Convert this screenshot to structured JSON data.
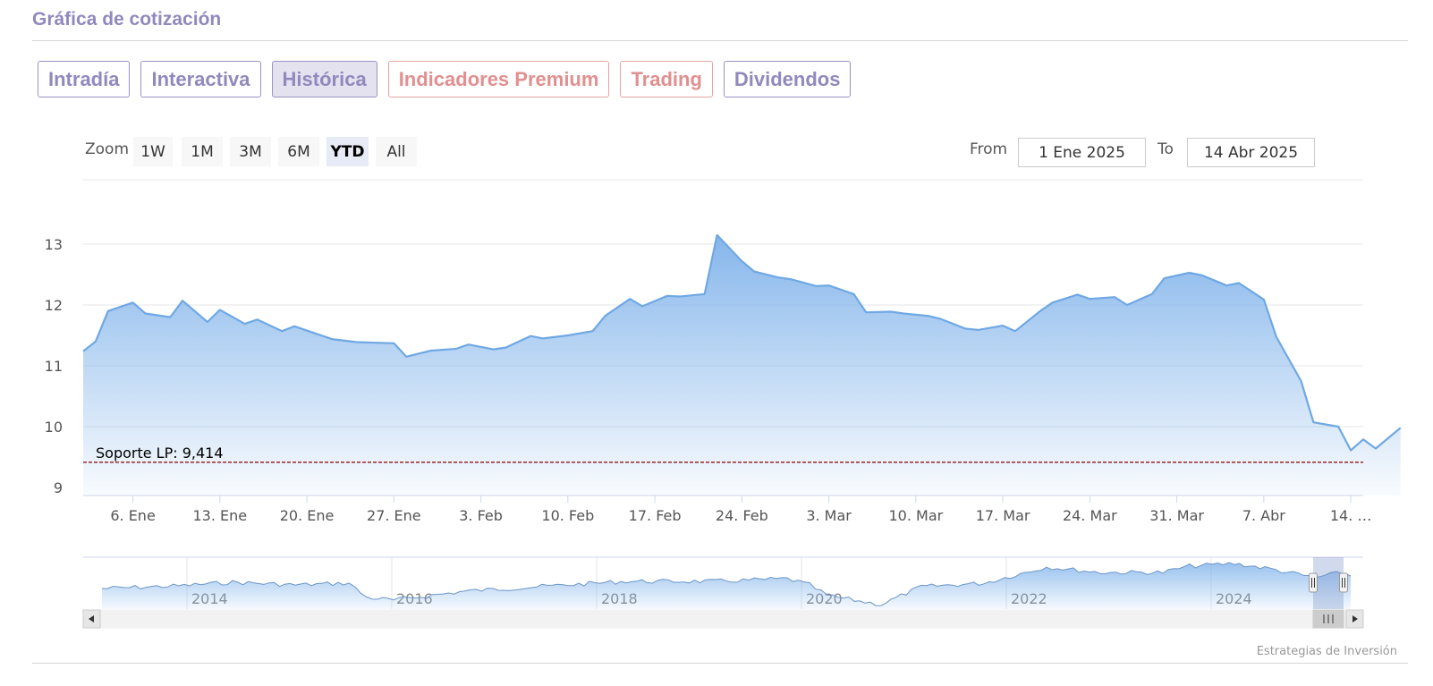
{
  "page_title": "Gráfica de cotización",
  "tabs": [
    {
      "label": "Intradía",
      "active": false,
      "premium": false
    },
    {
      "label": "Interactiva",
      "active": false,
      "premium": false
    },
    {
      "label": "Histórica",
      "active": true,
      "premium": false
    },
    {
      "label": "Indicadores Premium",
      "active": false,
      "premium": true
    },
    {
      "label": "Trading",
      "active": false,
      "premium": true
    },
    {
      "label": "Dividendos",
      "active": false,
      "premium": false
    }
  ],
  "zoom": {
    "label": "Zoom",
    "buttons": [
      "1W",
      "1M",
      "3M",
      "6M",
      "YTD",
      "All"
    ],
    "active": "YTD"
  },
  "range": {
    "from_label": "From",
    "from_value": "1 Ene 2025",
    "to_label": "To",
    "to_value": "14 Abr 2025"
  },
  "credit": "Estrategias de Inversión",
  "colors": {
    "accent": "#9189bd",
    "premium": "#e18f8f",
    "series_line": "#6fa8e3",
    "support_line": "#8b0000"
  },
  "chart_data": {
    "type": "area",
    "ylim": [
      9,
      13.4
    ],
    "y_ticks": [
      9,
      10,
      11,
      12,
      13
    ],
    "x_start": "2025-01-02",
    "x_end": "2025-04-15",
    "x_ticks": [
      {
        "date": "2025-01-06",
        "label": "6. Ene"
      },
      {
        "date": "2025-01-13",
        "label": "13. Ene"
      },
      {
        "date": "2025-01-20",
        "label": "20. Ene"
      },
      {
        "date": "2025-01-27",
        "label": "27. Ene"
      },
      {
        "date": "2025-02-03",
        "label": "3. Feb"
      },
      {
        "date": "2025-02-10",
        "label": "10. Feb"
      },
      {
        "date": "2025-02-17",
        "label": "17. Feb"
      },
      {
        "date": "2025-02-24",
        "label": "24. Feb"
      },
      {
        "date": "2025-03-03",
        "label": "3. Mar"
      },
      {
        "date": "2025-03-10",
        "label": "10. Mar"
      },
      {
        "date": "2025-03-17",
        "label": "17. Mar"
      },
      {
        "date": "2025-03-24",
        "label": "24. Mar"
      },
      {
        "date": "2025-03-31",
        "label": "31. Mar"
      },
      {
        "date": "2025-04-07",
        "label": "7. Abr"
      },
      {
        "date": "2025-04-14",
        "label": "14. …"
      }
    ],
    "series": [
      {
        "points": [
          [
            "2025-01-02",
            11.24
          ],
          [
            "2025-01-03",
            11.4
          ],
          [
            "2025-01-04",
            11.9
          ],
          [
            "2025-01-06",
            12.04
          ],
          [
            "2025-01-07",
            11.86
          ],
          [
            "2025-01-09",
            11.8
          ],
          [
            "2025-01-10",
            12.07
          ],
          [
            "2025-01-12",
            11.72
          ],
          [
            "2025-01-13",
            11.92
          ],
          [
            "2025-01-15",
            11.69
          ],
          [
            "2025-01-16",
            11.76
          ],
          [
            "2025-01-18",
            11.57
          ],
          [
            "2025-01-19",
            11.65
          ],
          [
            "2025-01-21",
            11.51
          ],
          [
            "2025-01-22",
            11.44
          ],
          [
            "2025-01-24",
            11.39
          ],
          [
            "2025-01-27",
            11.37
          ],
          [
            "2025-01-28",
            11.15
          ],
          [
            "2025-01-30",
            11.25
          ],
          [
            "2025-02-01",
            11.28
          ],
          [
            "2025-02-02",
            11.35
          ],
          [
            "2025-02-04",
            11.27
          ],
          [
            "2025-02-05",
            11.3
          ],
          [
            "2025-02-07",
            11.49
          ],
          [
            "2025-02-08",
            11.45
          ],
          [
            "2025-02-10",
            11.5
          ],
          [
            "2025-02-12",
            11.57
          ],
          [
            "2025-02-13",
            11.82
          ],
          [
            "2025-02-15",
            12.1
          ],
          [
            "2025-02-16",
            11.98
          ],
          [
            "2025-02-18",
            12.15
          ],
          [
            "2025-02-19",
            12.14
          ],
          [
            "2025-02-21",
            12.18
          ],
          [
            "2025-02-22",
            13.15
          ],
          [
            "2025-02-24",
            12.72
          ],
          [
            "2025-02-25",
            12.55
          ],
          [
            "2025-02-27",
            12.45
          ],
          [
            "2025-02-28",
            12.42
          ],
          [
            "2025-03-02",
            12.31
          ],
          [
            "2025-03-03",
            12.32
          ],
          [
            "2025-03-05",
            12.18
          ],
          [
            "2025-03-06",
            11.88
          ],
          [
            "2025-03-08",
            11.89
          ],
          [
            "2025-03-09",
            11.86
          ],
          [
            "2025-03-11",
            11.82
          ],
          [
            "2025-03-12",
            11.77
          ],
          [
            "2025-03-14",
            11.61
          ],
          [
            "2025-03-15",
            11.59
          ],
          [
            "2025-03-17",
            11.66
          ],
          [
            "2025-03-18",
            11.57
          ],
          [
            "2025-03-20",
            11.9
          ],
          [
            "2025-03-21",
            12.04
          ],
          [
            "2025-03-23",
            12.17
          ],
          [
            "2025-03-24",
            12.1
          ],
          [
            "2025-03-26",
            12.13
          ],
          [
            "2025-03-27",
            12.0
          ],
          [
            "2025-03-29",
            12.18
          ],
          [
            "2025-03-30",
            12.44
          ],
          [
            "2025-04-01",
            12.53
          ],
          [
            "2025-04-02",
            12.49
          ],
          [
            "2025-04-04",
            12.32
          ],
          [
            "2025-04-05",
            12.36
          ],
          [
            "2025-04-07",
            12.09
          ],
          [
            "2025-04-08",
            11.48
          ],
          [
            "2025-04-10",
            10.75
          ],
          [
            "2025-04-11",
            10.07
          ],
          [
            "2025-04-13",
            10.0
          ],
          [
            "2025-04-14",
            9.61
          ],
          [
            "2025-04-15",
            9.79
          ],
          [
            "2025-04-16",
            9.64
          ],
          [
            "2025-04-18",
            9.98
          ]
        ]
      }
    ],
    "annotations": [
      {
        "type": "hline",
        "value": 9.414,
        "label": "Soporte LP: 9,414",
        "style": "dashed"
      }
    ],
    "navigator": {
      "year_labels": [
        "2014",
        "2016",
        "2018",
        "2020",
        "2022",
        "2024"
      ]
    }
  }
}
